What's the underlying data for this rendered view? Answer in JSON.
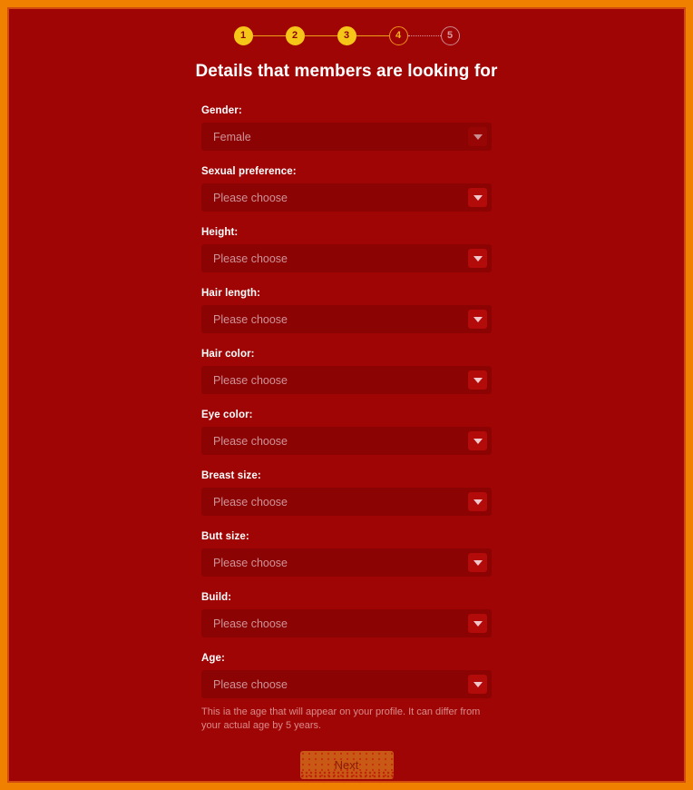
{
  "stepper": {
    "steps": [
      {
        "label": "1",
        "state": "done"
      },
      {
        "label": "2",
        "state": "done"
      },
      {
        "label": "3",
        "state": "done"
      },
      {
        "label": "4",
        "state": "current"
      },
      {
        "label": "5",
        "state": "pending"
      }
    ]
  },
  "header": {
    "title": "Details that members are looking for"
  },
  "form": {
    "placeholder": "Please choose",
    "fields": [
      {
        "label": "Gender:",
        "value": "Female",
        "filled": true
      },
      {
        "label": "Sexual preference:",
        "value": "Please choose",
        "filled": false
      },
      {
        "label": "Height:",
        "value": "Please choose",
        "filled": false
      },
      {
        "label": "Hair length:",
        "value": "Please choose",
        "filled": false
      },
      {
        "label": "Hair color:",
        "value": "Please choose",
        "filled": false
      },
      {
        "label": "Eye color:",
        "value": "Please choose",
        "filled": false
      },
      {
        "label": "Breast size:",
        "value": "Please choose",
        "filled": false
      },
      {
        "label": "Butt size:",
        "value": "Please choose",
        "filled": false
      },
      {
        "label": "Build:",
        "value": "Please choose",
        "filled": false
      },
      {
        "label": "Age:",
        "value": "Please choose",
        "filled": false
      }
    ],
    "age_helper": "This ia the age that will appear on your profile. It can differ from your actual age by 5 years."
  },
  "footer": {
    "next_label": "Next"
  },
  "colors": {
    "page_background": "#a00505",
    "outer_frame": "#f08000",
    "inner_border": "#d14b10",
    "input_background": "#8b0303",
    "accent_gold": "#f5c518",
    "accent_orange": "#f09018",
    "button_orange": "#c85a16",
    "label_white": "#ffffff",
    "placeholder_pink": "#cf9398"
  }
}
